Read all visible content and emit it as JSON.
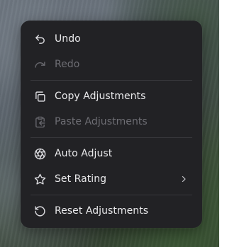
{
  "context_menu": {
    "items": [
      {
        "label": "Undo",
        "icon": "undo-icon",
        "enabled": true
      },
      {
        "label": "Redo",
        "icon": "redo-icon",
        "enabled": false
      },
      {
        "label": "Copy Adjustments",
        "icon": "copy-icon",
        "enabled": true
      },
      {
        "label": "Paste Adjustments",
        "icon": "paste-icon",
        "enabled": false
      },
      {
        "label": "Auto Adjust",
        "icon": "aperture-icon",
        "enabled": true
      },
      {
        "label": "Set Rating",
        "icon": "star-icon",
        "enabled": true,
        "submenu": true,
        "submenu_icon": "chevron-right-icon"
      },
      {
        "label": "Reset Adjustments",
        "icon": "reset-icon",
        "enabled": true
      }
    ]
  },
  "colors": {
    "menu_background": "#222225",
    "text_enabled": "#e9e9eb",
    "text_disabled": "#6e6e74",
    "separator": "#38383c"
  }
}
